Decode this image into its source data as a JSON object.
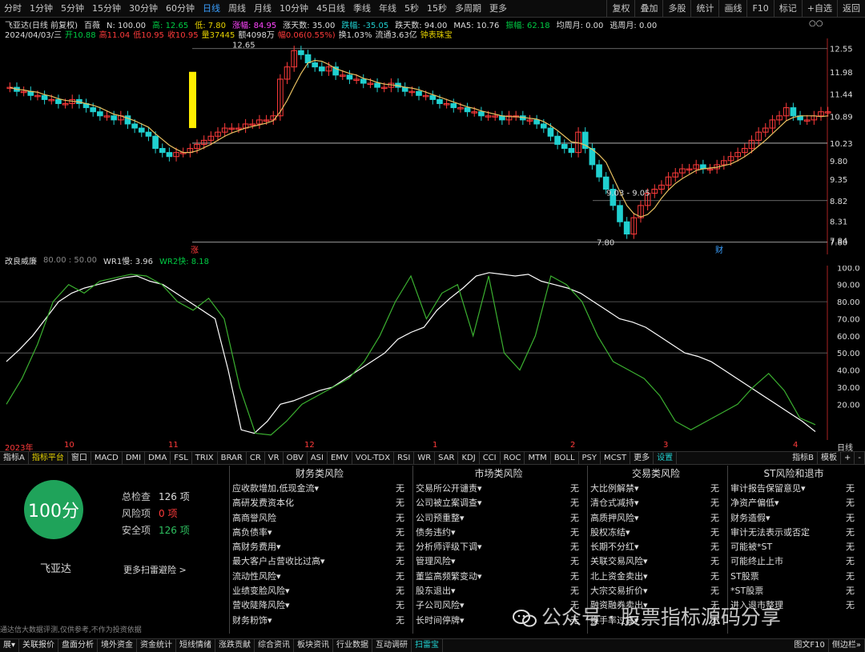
{
  "topbar": {
    "tabs": [
      "分时",
      "1分钟",
      "5分钟",
      "15分钟",
      "30分钟",
      "60分钟",
      "日线",
      "周线",
      "月线",
      "10分钟",
      "45日线",
      "季线",
      "年线",
      "5秒",
      "15秒",
      "多周期",
      "更多"
    ],
    "active_tab": "日线",
    "right_buttons": [
      "复权",
      "叠加",
      "多股",
      "统计",
      "画线",
      "F10",
      "标记",
      "+自选",
      "返回"
    ]
  },
  "info_line1": {
    "name": "飞亚达(日线 前复权)",
    "ind": "百薇",
    "N": "N: 100.00",
    "high": "高: 12.65",
    "low": "低: 7.80",
    "gain": "涨幅: 84.95",
    "rise_days": "涨天数: 35.00",
    "drop": "跌幅: -35.05",
    "fall_days": "跌天数: 94.00",
    "ma5": "MA5: 10.76",
    "amp": "振幅: 62.18",
    "avg_week": "均周月: 0.00",
    "escape": "逃周月: 0.00",
    "circle": "○○"
  },
  "info_line2": {
    "date": "2024/04/03/三",
    "open": "开10.88",
    "high": "高11.04",
    "low": "低10.95",
    "close": "收10.95",
    "vol": "量37445",
    "amount": "额4098万",
    "change": "幅0.06(0.55%)",
    "turnover": "换1.03%",
    "float": "流通3.63亿",
    "tag": "钟表珠宝"
  },
  "price_axis": [
    "12.55",
    "11.98",
    "11.44",
    "10.89",
    "10.23",
    "9.80",
    "9.35",
    "8.82",
    "8.31",
    "7.80",
    "7.84"
  ],
  "main_labels": {
    "top": "12.65",
    "mid": "9.03 - 9.05",
    "low": "7.80",
    "rise": "涨",
    "cai": "财"
  },
  "osc": {
    "title": "改良威廉",
    "param": "80.00 : 50.00",
    "wr1": "WR1慢: 3.96",
    "wr2": "WR2快: 8.18"
  },
  "osc_axis": [
    "100.0",
    "90.00",
    "80.00",
    "70.00",
    "60.00",
    "50.00",
    "40.00",
    "30.00",
    "20.00"
  ],
  "date_axis": [
    "2023年",
    "10",
    "11",
    "12",
    "1",
    "2",
    "3",
    "4",
    "日线"
  ],
  "indicator_tabs": [
    "指标A",
    "指标平台",
    "窗口",
    "MACD",
    "DMI",
    "DMA",
    "FSL",
    "TRIX",
    "BRAR",
    "CR",
    "VR",
    "OBV",
    "ASI",
    "EMV",
    "VOL-TDX",
    "RSI",
    "WR",
    "SAR",
    "KDJ",
    "CCI",
    "ROC",
    "MTM",
    "BOLL",
    "PSY",
    "MCST",
    "更多",
    "设置"
  ],
  "indicator_right": [
    "指标B",
    "模板",
    "+",
    "-"
  ],
  "panel": {
    "score": "100分",
    "stock_name": "飞亚达",
    "more": "更多扫雷避险 >",
    "disclaimer": "通达信大数据评测,仅供参考,不作为投资依据",
    "stats": [
      {
        "label": "总检查",
        "value": "126 项"
      },
      {
        "label": "风险项",
        "value": "0 项"
      },
      {
        "label": "安全项",
        "value": "126 项"
      }
    ],
    "columns": [
      {
        "title": "财务类风险",
        "items": [
          "应收款增加,低现金流▾",
          "高研发费资本化",
          "高商誉风险",
          "高负债率▾",
          "高财务费用▾",
          "最大客户占营收比过高▾",
          "流动性风险▾",
          "业绩变脸风险▾",
          "营收陡降风险▾",
          "财务粉饰▾"
        ],
        "status": "无"
      },
      {
        "title": "市场类风险",
        "items": [
          "交易所公开谴责▾",
          "公司被立案调查▾",
          "公司预重整▾",
          "债务违约▾",
          "分析师评级下调▾",
          "管理风险▾",
          "董监高频繁变动▾",
          "股东退出▾",
          "子公司风险▾",
          "长时间停牌▾"
        ],
        "status": "无"
      },
      {
        "title": "交易类风险",
        "items": [
          "大比例解禁▾",
          "清仓式减持▾",
          "高质押风险▾",
          "股权冻结▾",
          "长期不分红▾",
          "关联交易风险▾",
          "北上资金卖出▾",
          "大宗交易折价▾",
          "融资融券卖出▾",
          "换手率过高▾"
        ],
        "status": "无"
      },
      {
        "title": "ST风险和退市",
        "items": [
          "审计报告保留意见▾",
          "净资产偏低▾",
          "财务造假▾",
          "审计无法表示或否定",
          "可能被*ST",
          "可能终止上市",
          "ST股票",
          "*ST股票",
          "进入退市整理"
        ],
        "status": "无"
      }
    ]
  },
  "bottom_tabs": [
    "展▾",
    "关联报价",
    "盘面分析",
    "境外资金",
    "资金统计",
    "短线情绪",
    "涨跌贡献",
    "综合资讯",
    "板块资讯",
    "行业数据",
    "互动调研",
    "扫雷宝"
  ],
  "bottom_active": "扫雷宝",
  "bottom_right": "图文F10",
  "bottom_right2": "侧边栏»",
  "watermark": "公众号 · 股票指标源码分享",
  "colors": {
    "up": "#ff3b3b",
    "down": "#20d0d0",
    "ma": "#e8c060",
    "wr1": "#ffffff",
    "wr2": "#3bb030",
    "score_bg": "#1fa35a"
  },
  "chart_data": [
    {
      "type": "candlestick",
      "title": "飞亚达(日线 前复权)",
      "ylim": [
        7.5,
        12.8
      ],
      "ohlc_close": [
        11.6,
        11.5,
        11.5,
        11.4,
        11.4,
        11.3,
        11.3,
        11.2,
        11.2,
        11.3,
        11.2,
        11.1,
        11.0,
        10.9,
        10.9,
        10.8,
        10.9,
        10.7,
        10.6,
        10.5,
        10.4,
        10.1,
        10.0,
        9.9,
        10.0,
        10.0,
        10.1,
        10.2,
        10.3,
        10.4,
        10.5,
        10.6,
        10.6,
        10.6,
        10.7,
        10.7,
        10.8,
        10.8,
        10.9,
        11.8,
        12.1,
        12.5,
        12.4,
        12.2,
        12.1,
        12.0,
        12.1,
        11.9,
        11.9,
        11.8,
        11.8,
        11.7,
        11.7,
        11.6,
        11.6,
        11.7,
        11.6,
        11.5,
        11.5,
        11.4,
        11.4,
        11.3,
        11.2,
        11.2,
        11.1,
        11.1,
        11.0,
        11.0,
        10.9,
        10.9,
        10.9,
        10.8,
        10.9,
        10.9,
        10.8,
        10.8,
        10.7,
        10.6,
        10.4,
        10.2,
        10.1,
        10.0,
        10.5,
        10.1,
        9.7,
        9.4,
        9.1,
        8.7,
        8.3,
        8.0,
        8.4,
        8.7,
        9.0,
        9.1,
        9.2,
        9.4,
        9.5,
        9.6,
        9.6,
        9.7,
        9.6,
        9.6,
        9.7,
        9.8,
        9.9,
        10.0,
        10.1,
        10.3,
        10.5,
        10.6,
        10.8,
        10.9,
        11.1,
        10.9,
        10.8,
        10.8,
        10.9,
        11.0,
        11.0
      ],
      "ma_label": "MA5",
      "ma5_last": 10.76,
      "lines": [
        10.23,
        7.8
      ]
    },
    {
      "type": "line",
      "title": "改良威廉",
      "ylim": [
        0,
        100
      ],
      "series": [
        {
          "name": "WR1慢",
          "values": [
            45,
            52,
            60,
            70,
            80,
            85,
            88,
            90,
            92,
            94,
            95,
            92,
            90,
            85,
            80,
            75,
            70,
            40,
            5,
            3,
            10,
            20,
            22,
            25,
            28,
            30,
            35,
            40,
            45,
            50,
            58,
            62,
            65,
            75,
            82,
            88,
            95,
            97,
            96,
            95,
            96,
            92,
            90,
            88,
            85,
            80,
            75,
            70,
            68,
            65,
            60,
            55,
            50,
            48,
            45,
            40,
            35,
            30,
            25,
            20,
            15,
            10,
            4
          ]
        },
        {
          "name": "WR2快",
          "values": [
            20,
            35,
            55,
            80,
            90,
            85,
            92,
            94,
            96,
            95,
            90,
            80,
            75,
            82,
            70,
            30,
            3,
            2,
            10,
            20,
            25,
            30,
            35,
            45,
            60,
            80,
            95,
            70,
            85,
            90,
            60,
            95,
            50,
            40,
            60,
            95,
            90,
            80,
            60,
            45,
            40,
            35,
            25,
            10,
            5,
            10,
            15,
            20,
            30,
            38,
            28,
            12,
            8
          ]
        }
      ]
    }
  ]
}
